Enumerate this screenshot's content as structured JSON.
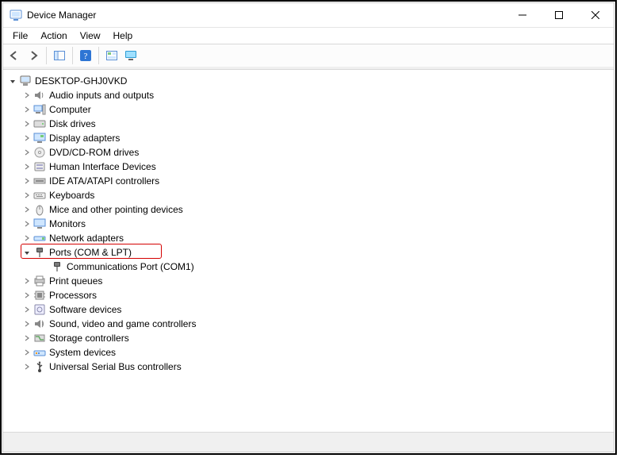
{
  "window": {
    "title": "Device Manager"
  },
  "menu": [
    "File",
    "Action",
    "View",
    "Help"
  ],
  "root": {
    "label": "DESKTOP-GHJ0VKD",
    "icon": "computer-icon",
    "expanded": true
  },
  "categories": [
    {
      "label": "Audio inputs and outputs",
      "icon": "speaker-icon",
      "expanded": false,
      "children": []
    },
    {
      "label": "Computer",
      "icon": "pc-icon",
      "expanded": false,
      "children": []
    },
    {
      "label": "Disk drives",
      "icon": "disk-icon",
      "expanded": false,
      "children": []
    },
    {
      "label": "Display adapters",
      "icon": "display-icon",
      "expanded": false,
      "children": []
    },
    {
      "label": "DVD/CD-ROM drives",
      "icon": "cd-icon",
      "expanded": false,
      "children": []
    },
    {
      "label": "Human Interface Devices",
      "icon": "hid-icon",
      "expanded": false,
      "children": []
    },
    {
      "label": "IDE ATA/ATAPI controllers",
      "icon": "ide-icon",
      "expanded": false,
      "children": []
    },
    {
      "label": "Keyboards",
      "icon": "keyboard-icon",
      "expanded": false,
      "children": []
    },
    {
      "label": "Mice and other pointing devices",
      "icon": "mouse-icon",
      "expanded": false,
      "children": []
    },
    {
      "label": "Monitors",
      "icon": "monitor-icon",
      "expanded": false,
      "children": []
    },
    {
      "label": "Network adapters",
      "icon": "network-icon",
      "expanded": false,
      "children": []
    },
    {
      "label": "Ports (COM & LPT)",
      "icon": "port-icon",
      "expanded": true,
      "children": [
        {
          "label": "Communications Port (COM1)",
          "icon": "port-icon"
        }
      ]
    },
    {
      "label": "Print queues",
      "icon": "printer-icon",
      "expanded": false,
      "children": []
    },
    {
      "label": "Processors",
      "icon": "cpu-icon",
      "expanded": false,
      "children": []
    },
    {
      "label": "Software devices",
      "icon": "software-icon",
      "expanded": false,
      "children": []
    },
    {
      "label": "Sound, video and game controllers",
      "icon": "sound-icon",
      "expanded": false,
      "children": []
    },
    {
      "label": "Storage controllers",
      "icon": "storage-icon",
      "expanded": false,
      "children": []
    },
    {
      "label": "System devices",
      "icon": "system-icon",
      "expanded": false,
      "children": []
    },
    {
      "label": "Universal Serial Bus controllers",
      "icon": "usb-icon",
      "expanded": false,
      "children": []
    }
  ]
}
